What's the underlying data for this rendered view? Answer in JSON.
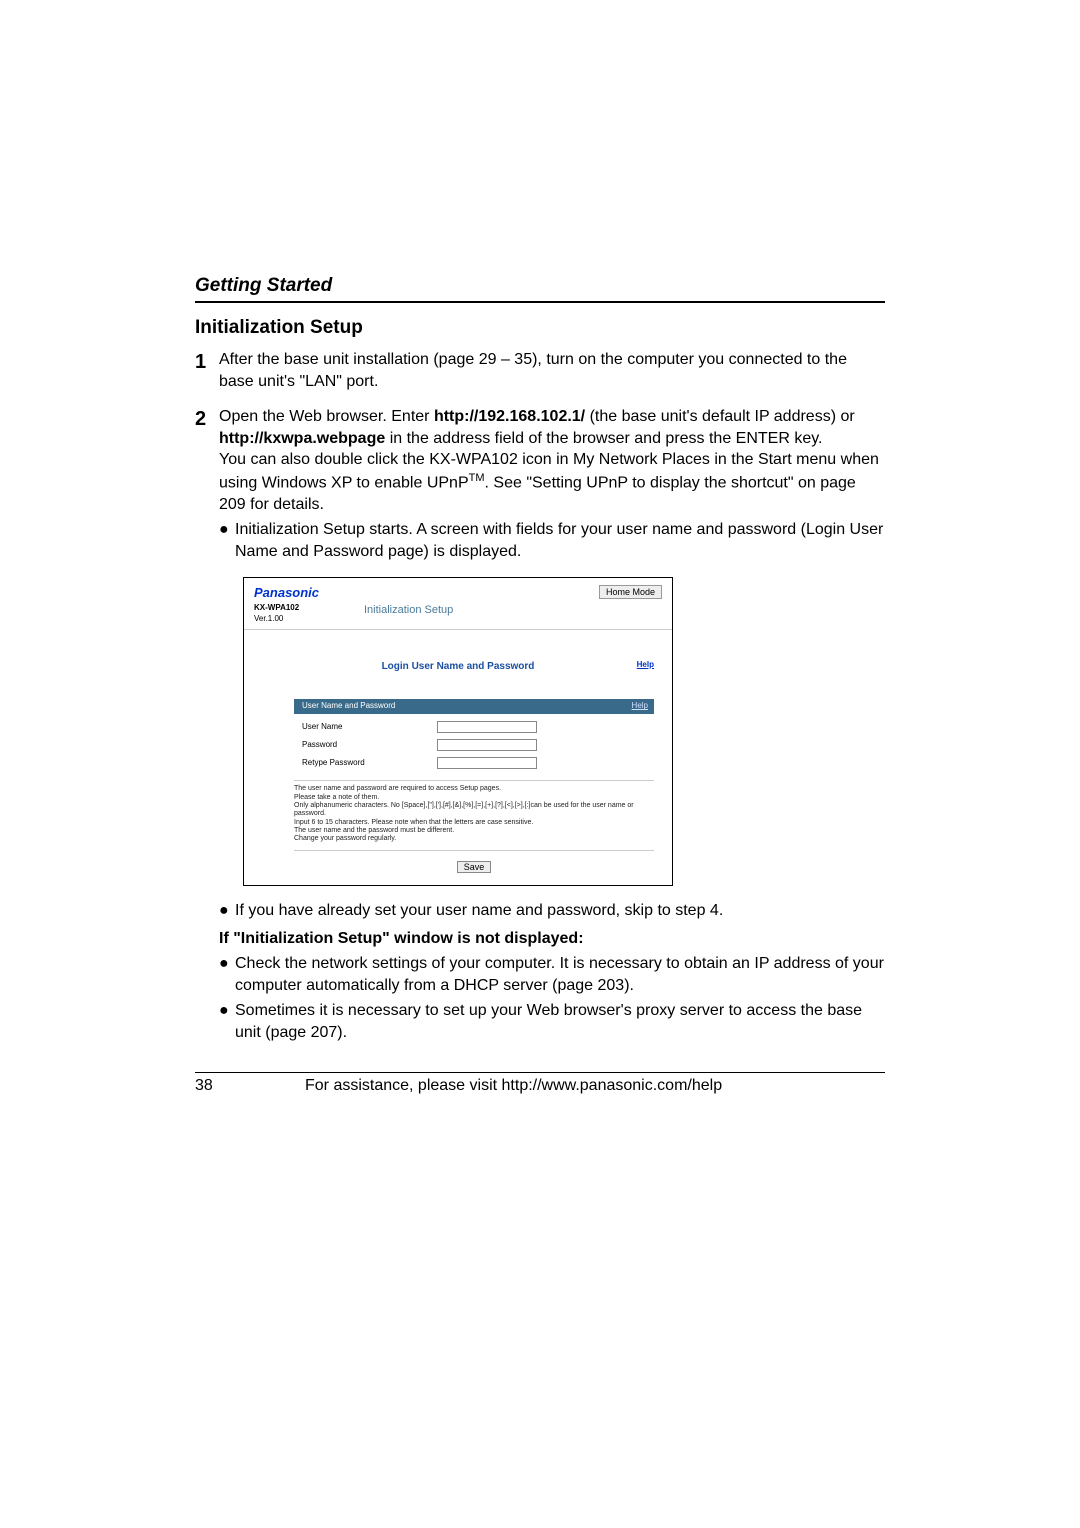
{
  "header": {
    "section": "Getting Started",
    "subsection": "Initialization Setup"
  },
  "steps": {
    "s1": {
      "num": "1",
      "text_a": "After the base unit installation (page 29 – 35), turn on the computer you connected to the base unit's \"LAN\" port."
    },
    "s2": {
      "num": "2",
      "text_a": "Open the Web browser. Enter ",
      "url1": "http://192.168.102.1/",
      "text_b": " (the base unit's default IP address) or ",
      "url2": "http://kxwpa.webpage",
      "text_c": " in the address field of the browser and press the ENTER key.",
      "text_d": "You can also double click the KX-WPA102 icon in My Network Places in the Start menu when using Windows XP to enable UPnP",
      "tm": "TM",
      "text_e": ". See \"Setting UPnP to display the shortcut\" on page 209 for details.",
      "bullet1": "Initialization Setup starts. A screen with fields for your user name and password (Login User Name and Password page) is displayed."
    }
  },
  "screenshot": {
    "brand": "Panasonic",
    "mode_button": "Home Mode",
    "model": "KX-WPA102",
    "version": "Ver.1.00",
    "init_title": "Initialization Setup",
    "login_title": "Login User Name and Password",
    "help": "Help",
    "band_title": "User Name and Password",
    "fields": {
      "username": "User Name",
      "password": "Password",
      "retype": "Retype Password"
    },
    "notes_line1": "The user name and password are required to access Setup pages.",
    "notes_line2": "Please take a note of them.",
    "notes_line3": "Only alphanumeric characters. No [Space],[\"],['],[#],[&],[%],[=],[+],[?],[<],[>],[:]can be used for the user name or password.",
    "notes_line4": "Input 6 to 15 characters. Please note when that the letters are case sensitive.",
    "notes_line5": "The user name and the password must be different.",
    "notes_line6": "Change your password regularly.",
    "save": "Save"
  },
  "after": {
    "b1": "If you have already set your user name and password, skip to step 4.",
    "bold": "If \"Initialization Setup\" window is not displayed:",
    "b2": "Check the network settings of your computer. It is necessary to obtain an IP address of your computer automatically from a DHCP server (page 203).",
    "b3": "Sometimes it is necessary to set up your Web browser's proxy server to access the base unit (page 207)."
  },
  "footer": {
    "page": "38",
    "assist": "For assistance, please visit http://www.panasonic.com/help"
  },
  "glyph": {
    "bullet": "●"
  }
}
